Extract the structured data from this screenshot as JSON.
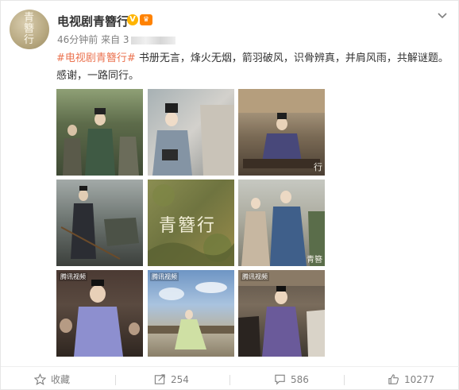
{
  "post": {
    "avatar_text": "青簪行",
    "username": "电视剧青簪行",
    "time": "46分钟前",
    "source_prefix": "来自 3",
    "hashtag": "#电视剧青簪行#",
    "body": " 书册无言，烽火无烟，箭羽破风，识骨辨真，并肩风雨，共解谜题。感谢，一路同行。"
  },
  "images": [
    {
      "watermark": "",
      "overlay_text": ""
    },
    {
      "watermark": "",
      "overlay_text": ""
    },
    {
      "watermark": "",
      "overlay_text": "行"
    },
    {
      "watermark": "",
      "overlay_text": ""
    },
    {
      "watermark": "",
      "overlay_text": "青簪行"
    },
    {
      "watermark": "",
      "overlay_text": "青簪"
    },
    {
      "watermark": "腾讯视频",
      "overlay_text": ""
    },
    {
      "watermark": "腾讯视频",
      "overlay_text": ""
    },
    {
      "watermark": "腾讯视频",
      "overlay_text": ""
    }
  ],
  "actions": {
    "favorite_label": "收藏",
    "repost_count": "254",
    "comment_count": "586",
    "like_count": "10277"
  },
  "colors": {
    "hashtag": "#eb7350",
    "verified": "#ffb400",
    "muted": "#808080"
  }
}
